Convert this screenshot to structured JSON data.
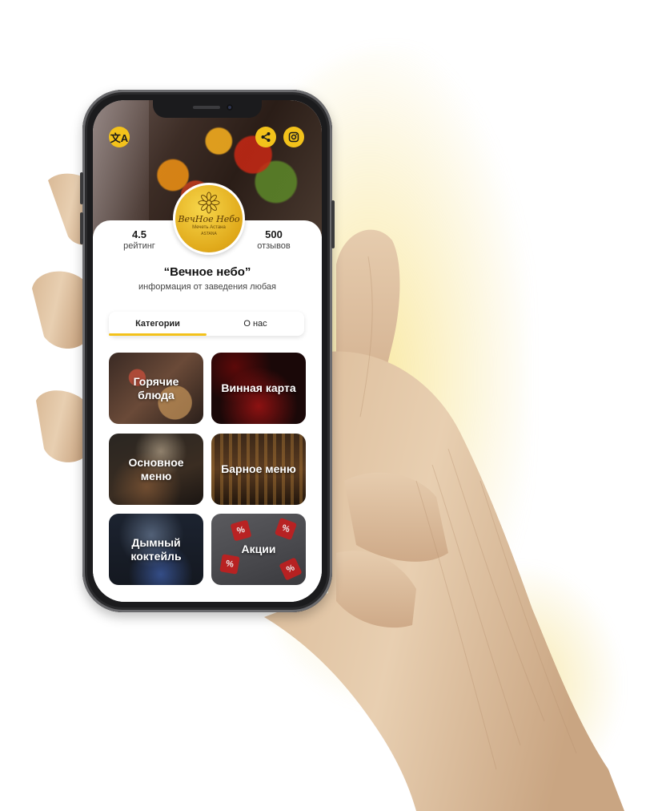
{
  "app": {
    "venue_logo": {
      "name": "ВечНое Небо",
      "subtitle": "Мечеть Астана",
      "city": "ASTANA"
    },
    "top_buttons": {
      "left_icon": "translate-icon",
      "right_icons": [
        "share-icon",
        "instagram-icon"
      ]
    },
    "stats": {
      "rating_value": "4.5",
      "rating_label": "рейтинг",
      "reviews_value": "500",
      "reviews_label": "отзывов"
    },
    "venue": {
      "title": "“Вечное небо”",
      "description": "информация от заведения любая"
    },
    "tabs": [
      {
        "label": "Категории",
        "active": true
      },
      {
        "label": "О нас",
        "active": false
      }
    ],
    "categories": [
      {
        "label": "Горячие блюда"
      },
      {
        "label": "Винная карта"
      },
      {
        "label": "Основное меню"
      },
      {
        "label": "Барное меню"
      },
      {
        "label": "Дымный коктейль"
      },
      {
        "label": "Акции"
      }
    ],
    "colors": {
      "accent": "#f3c21b",
      "text": "#111111",
      "background": "#ffffff"
    }
  }
}
